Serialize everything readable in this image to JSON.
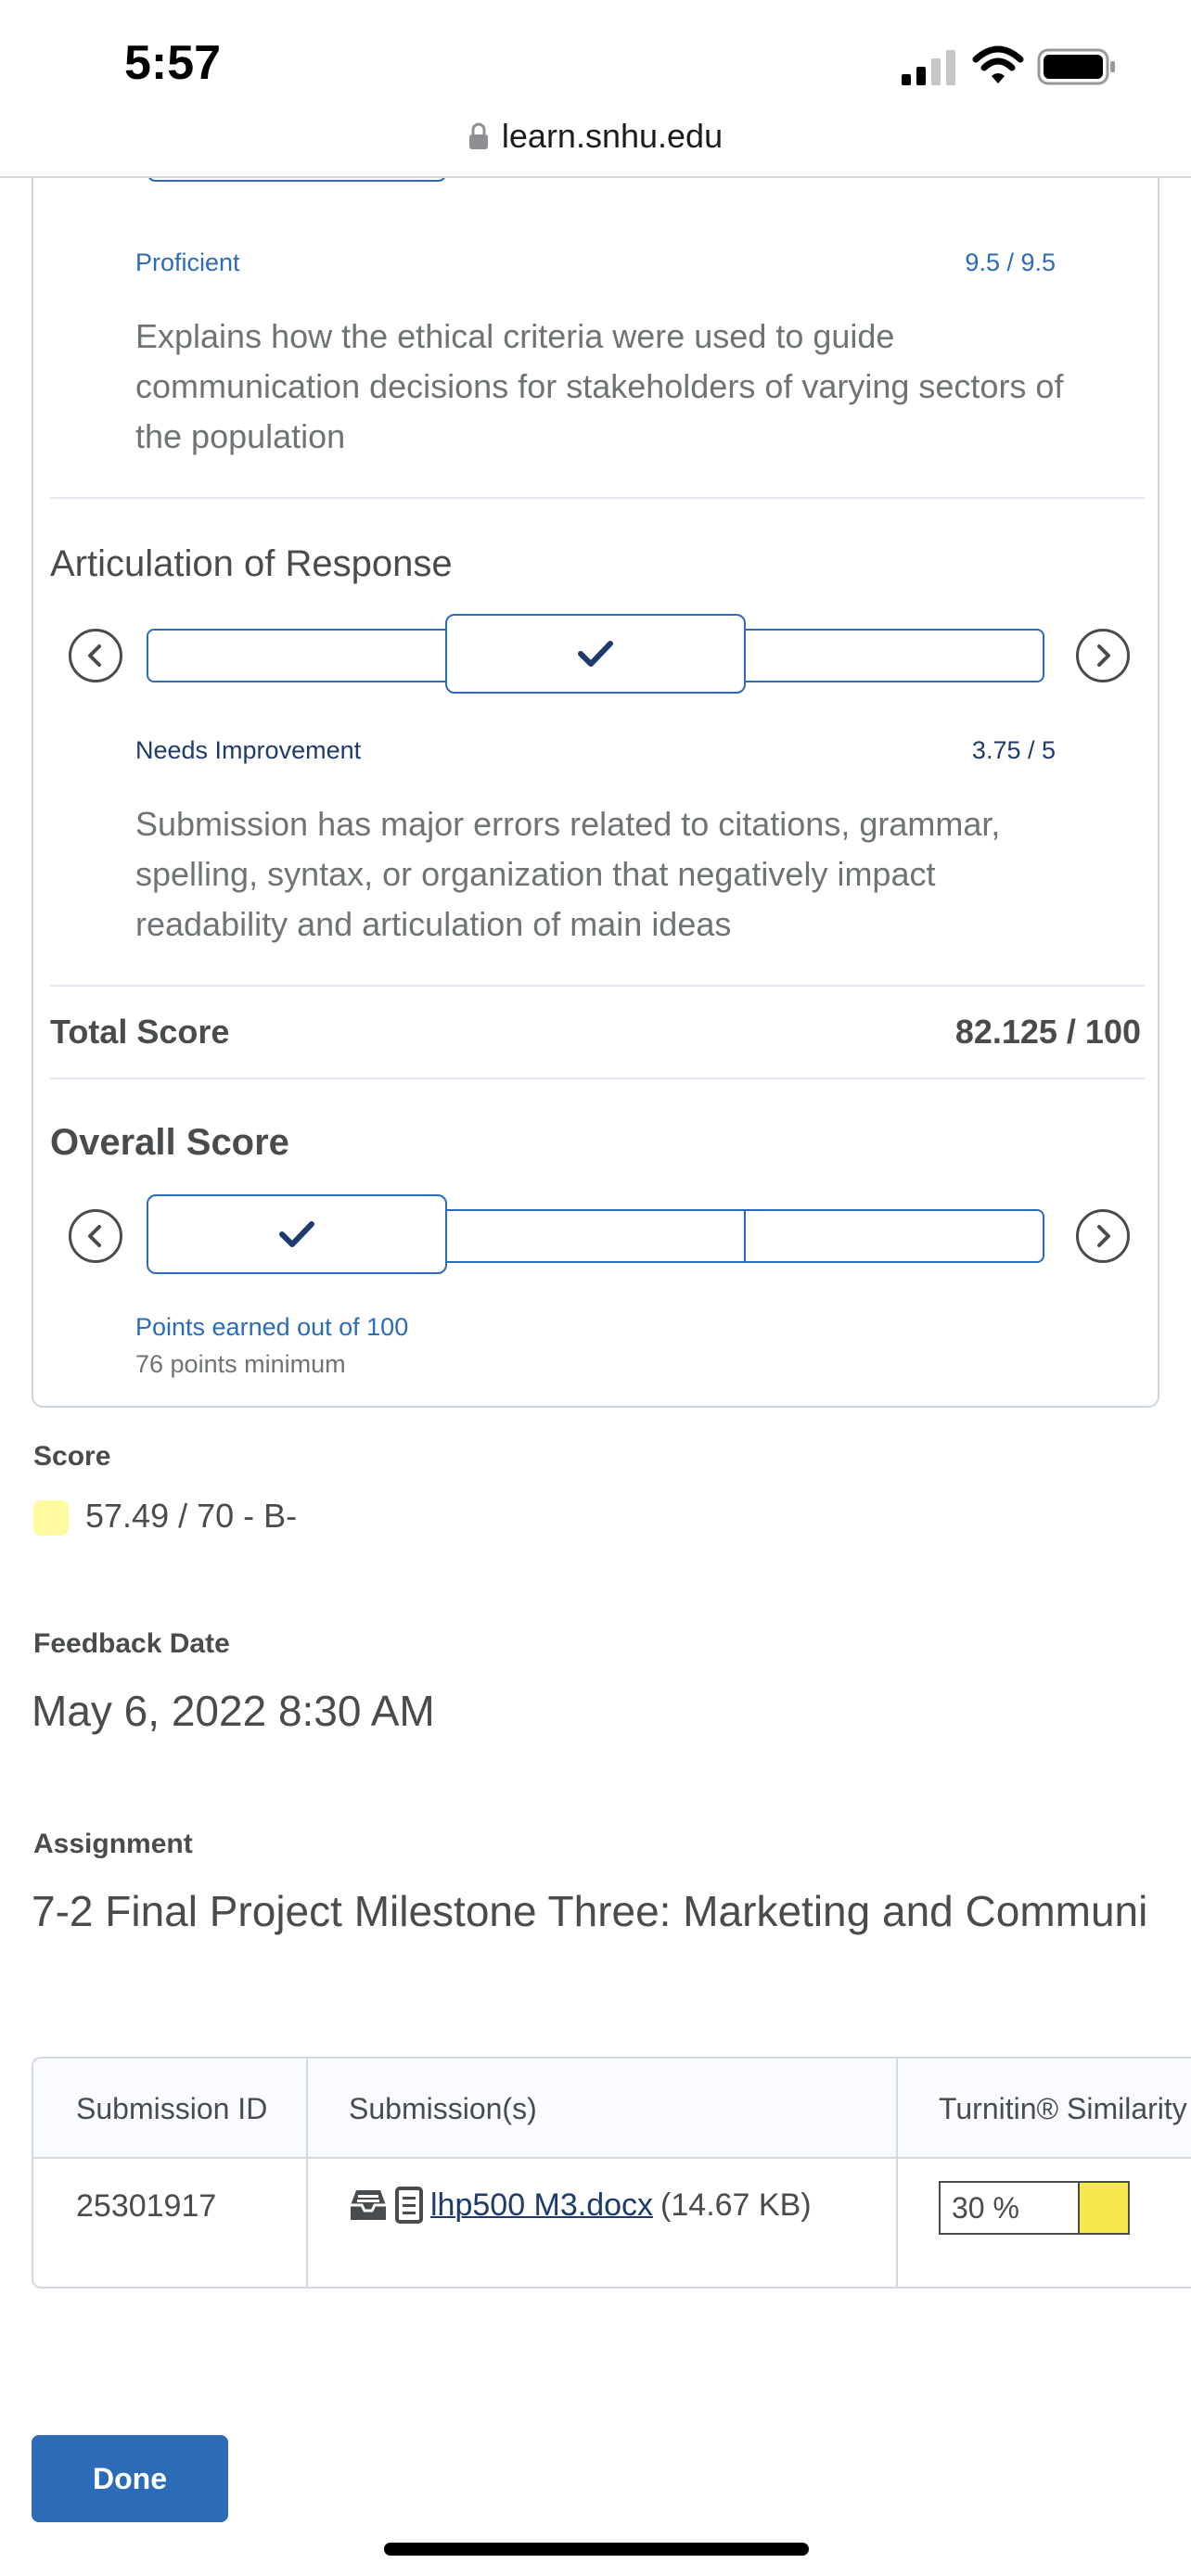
{
  "status_bar": {
    "time": "5:57",
    "url": "learn.snhu.edu"
  },
  "rubric": {
    "criterion_top": {
      "level_name": "Proficient",
      "points": "9.5 / 9.5",
      "description": "Explains how the ethical criteria were used to guide communication decisions for stakeholders of varying sectors of the population"
    },
    "criterion_articulation": {
      "title": "Articulation of Response",
      "selected_level_index": 1,
      "level_name": "Needs Improvement",
      "points": "3.75 / 5",
      "description": "Submission has major errors related to citations, grammar, spelling, syntax, or organization that negatively impact readability and articulation of main ideas"
    },
    "total": {
      "label": "Total Score",
      "value": "82.125 / 100"
    },
    "overall": {
      "title": "Overall Score",
      "selected_level_index": 0,
      "level_name": "Points earned out of 100",
      "minimum": "76 points minimum"
    }
  },
  "score": {
    "label": "Score",
    "value": "57.49 / 70 - B-",
    "swatch_color": "#fdfaa0"
  },
  "feedback_date": {
    "label": "Feedback Date",
    "value": "May 6, 2022 8:30 AM"
  },
  "assignment": {
    "label": "Assignment",
    "value": "7-2 Final Project Milestone Three: Marketing and Communi"
  },
  "submissions_table": {
    "headers": [
      "Submission ID",
      "Submission(s)",
      "Turnitin® Similarity"
    ],
    "rows": [
      {
        "id": "25301917",
        "file_name": "lhp500 M3.docx",
        "file_size": "(14.67 KB)",
        "similarity": "30 %",
        "similarity_color": "#f5e94f"
      }
    ]
  },
  "done_button": {
    "label": "Done"
  },
  "colors": {
    "accent": "#2c6bb5",
    "dark_accent": "#1f3b6b",
    "text": "#494c4e"
  }
}
